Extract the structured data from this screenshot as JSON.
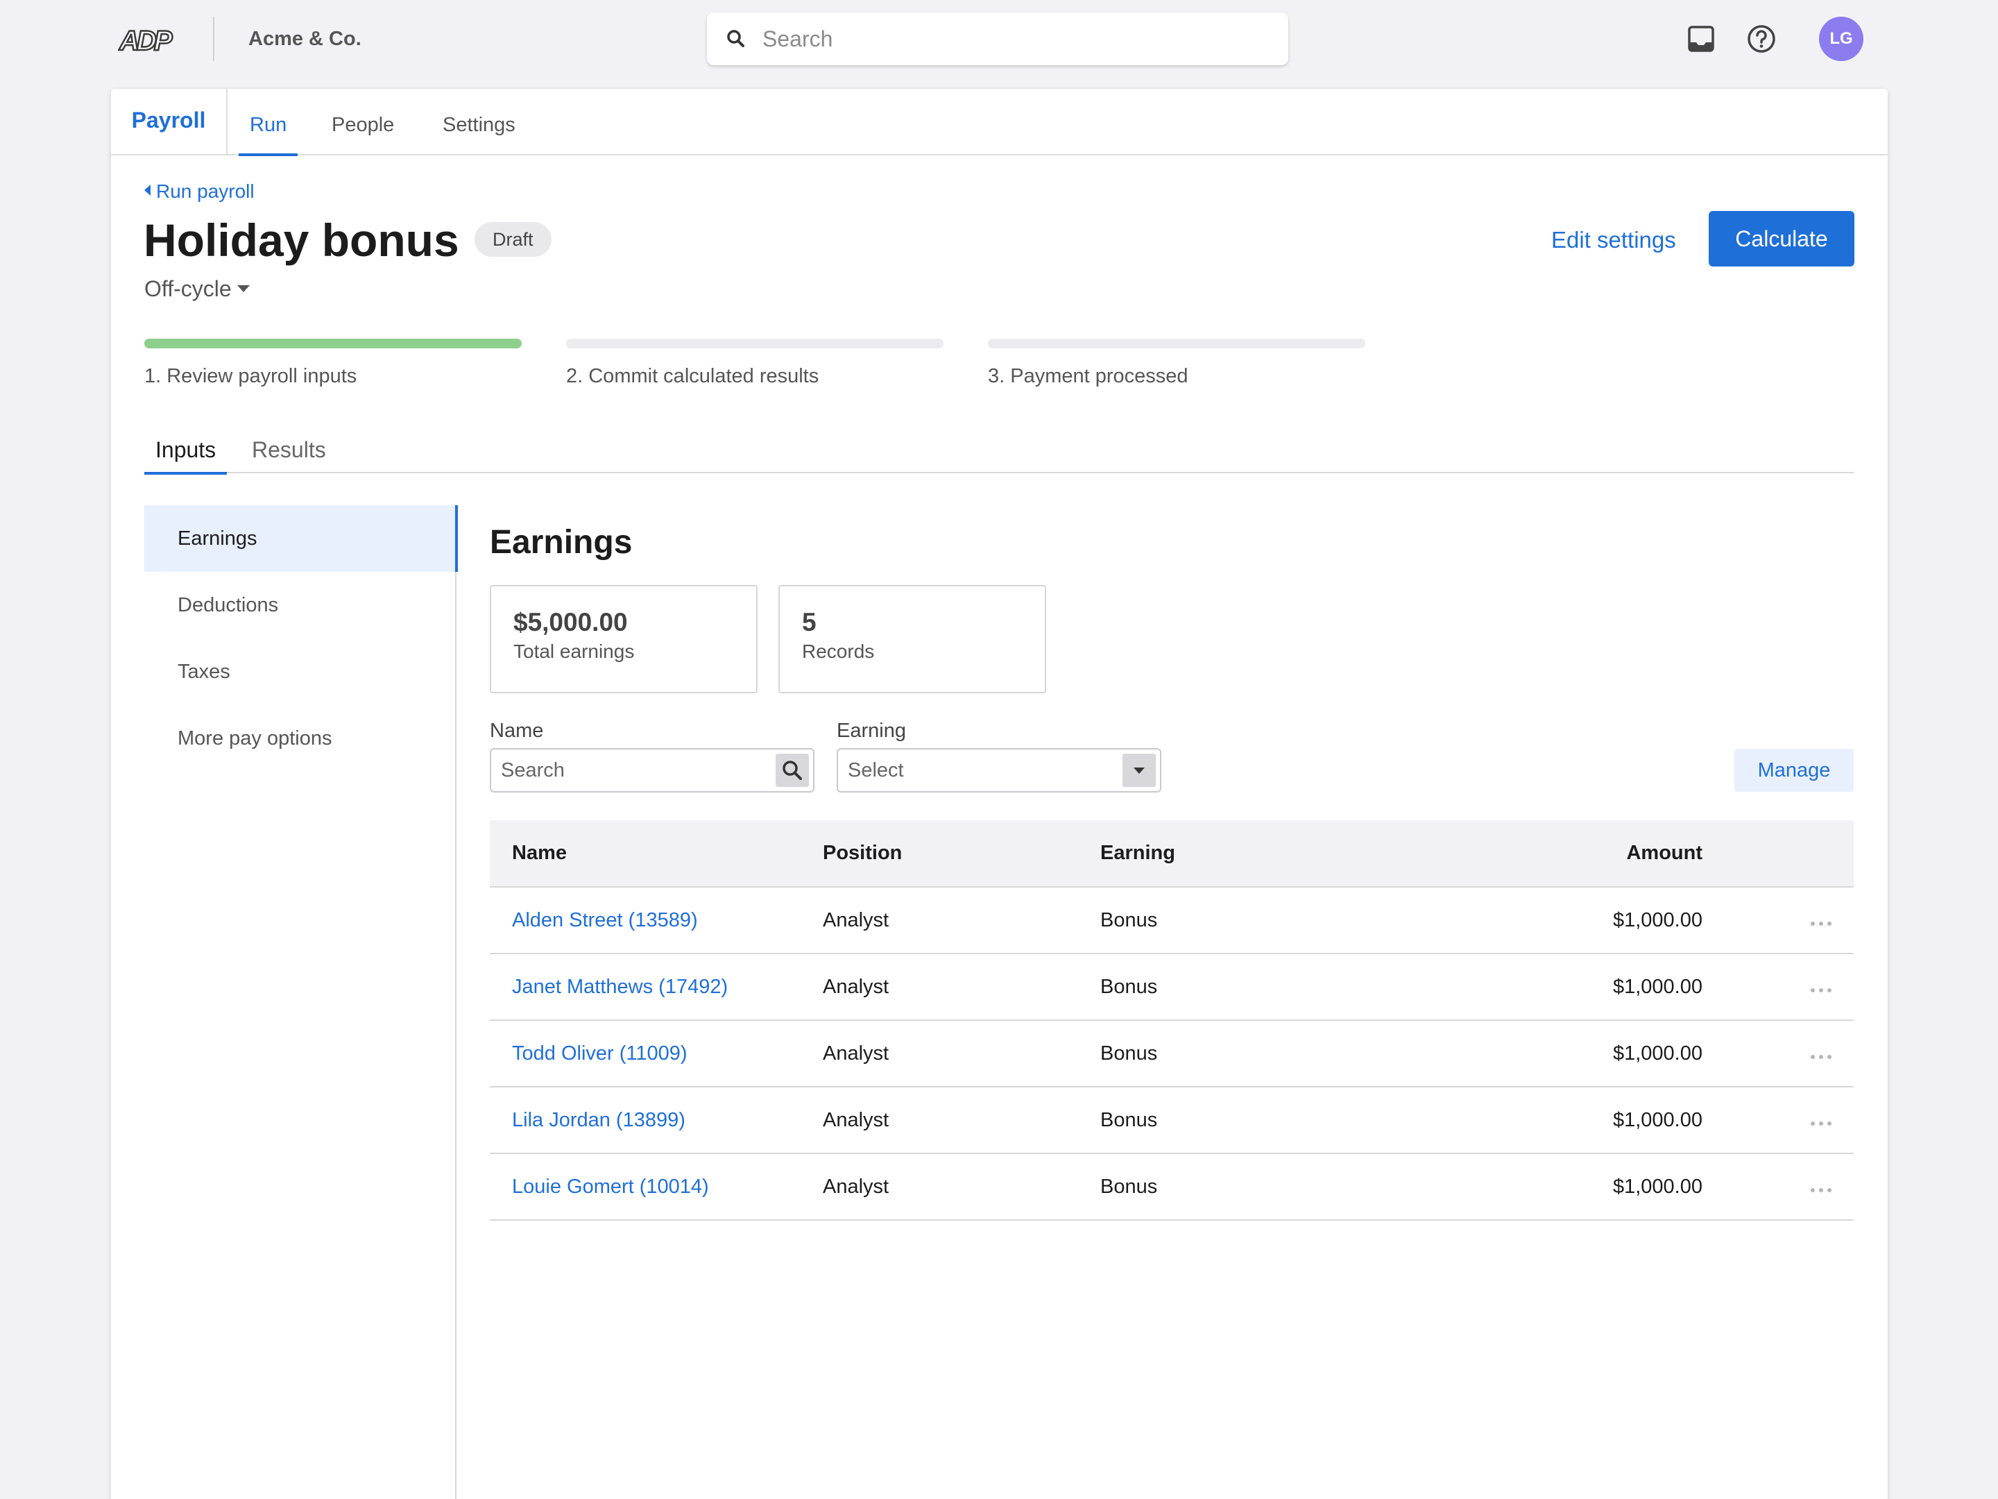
{
  "topbar": {
    "logo_text": "ADP",
    "company": "Acme & Co.",
    "search_placeholder": "Search",
    "avatar_initials": "LG"
  },
  "tabs": {
    "app": "Payroll",
    "items": [
      {
        "label": "Run",
        "active": true
      },
      {
        "label": "People",
        "active": false
      },
      {
        "label": "Settings",
        "active": false
      }
    ]
  },
  "header": {
    "back_link": "Run payroll",
    "title": "Holiday bonus",
    "badge": "Draft",
    "subtype": "Off-cycle",
    "edit_settings": "Edit settings",
    "calculate": "Calculate"
  },
  "steps": [
    {
      "label": "1. Review payroll inputs",
      "progress": 1.0
    },
    {
      "label": "2. Commit calculated results",
      "progress": 0.0
    },
    {
      "label": "3. Payment processed",
      "progress": 0.0
    }
  ],
  "sub_tabs": {
    "inputs": "Inputs",
    "results": "Results"
  },
  "sidenav": [
    "Earnings",
    "Deductions",
    "Taxes",
    "More pay options"
  ],
  "section": {
    "title": "Earnings",
    "stats": [
      {
        "value": "$5,000.00",
        "label": "Total earnings"
      },
      {
        "value": "5",
        "label": "Records"
      }
    ],
    "filters": {
      "name_label": "Name",
      "name_placeholder": "Search",
      "earning_label": "Earning",
      "earning_value": "Select",
      "manage": "Manage"
    }
  },
  "table": {
    "columns": {
      "name": "Name",
      "position": "Position",
      "earning": "Earning",
      "amount": "Amount"
    },
    "rows": [
      {
        "name": "Alden Street (13589)",
        "position": "Analyst",
        "earning": "Bonus",
        "amount": "$1,000.00"
      },
      {
        "name": "Janet Matthews (17492)",
        "position": "Analyst",
        "earning": "Bonus",
        "amount": "$1,000.00"
      },
      {
        "name": "Todd Oliver (11009)",
        "position": "Analyst",
        "earning": "Bonus",
        "amount": "$1,000.00"
      },
      {
        "name": "Lila Jordan (13899)",
        "position": "Analyst",
        "earning": "Bonus",
        "amount": "$1,000.00"
      },
      {
        "name": "Louie Gomert (10014)",
        "position": "Analyst",
        "earning": "Bonus",
        "amount": "$1,000.00"
      }
    ]
  },
  "colors": {
    "accent": "#1f6fd8",
    "progress_done": "#8fcf8d",
    "avatar": "#8b7cf0"
  },
  "icons": [
    "adp-logo",
    "search-icon",
    "inbox-icon",
    "help-icon",
    "chevron-left-icon",
    "chevron-down-icon",
    "more-icon"
  ]
}
